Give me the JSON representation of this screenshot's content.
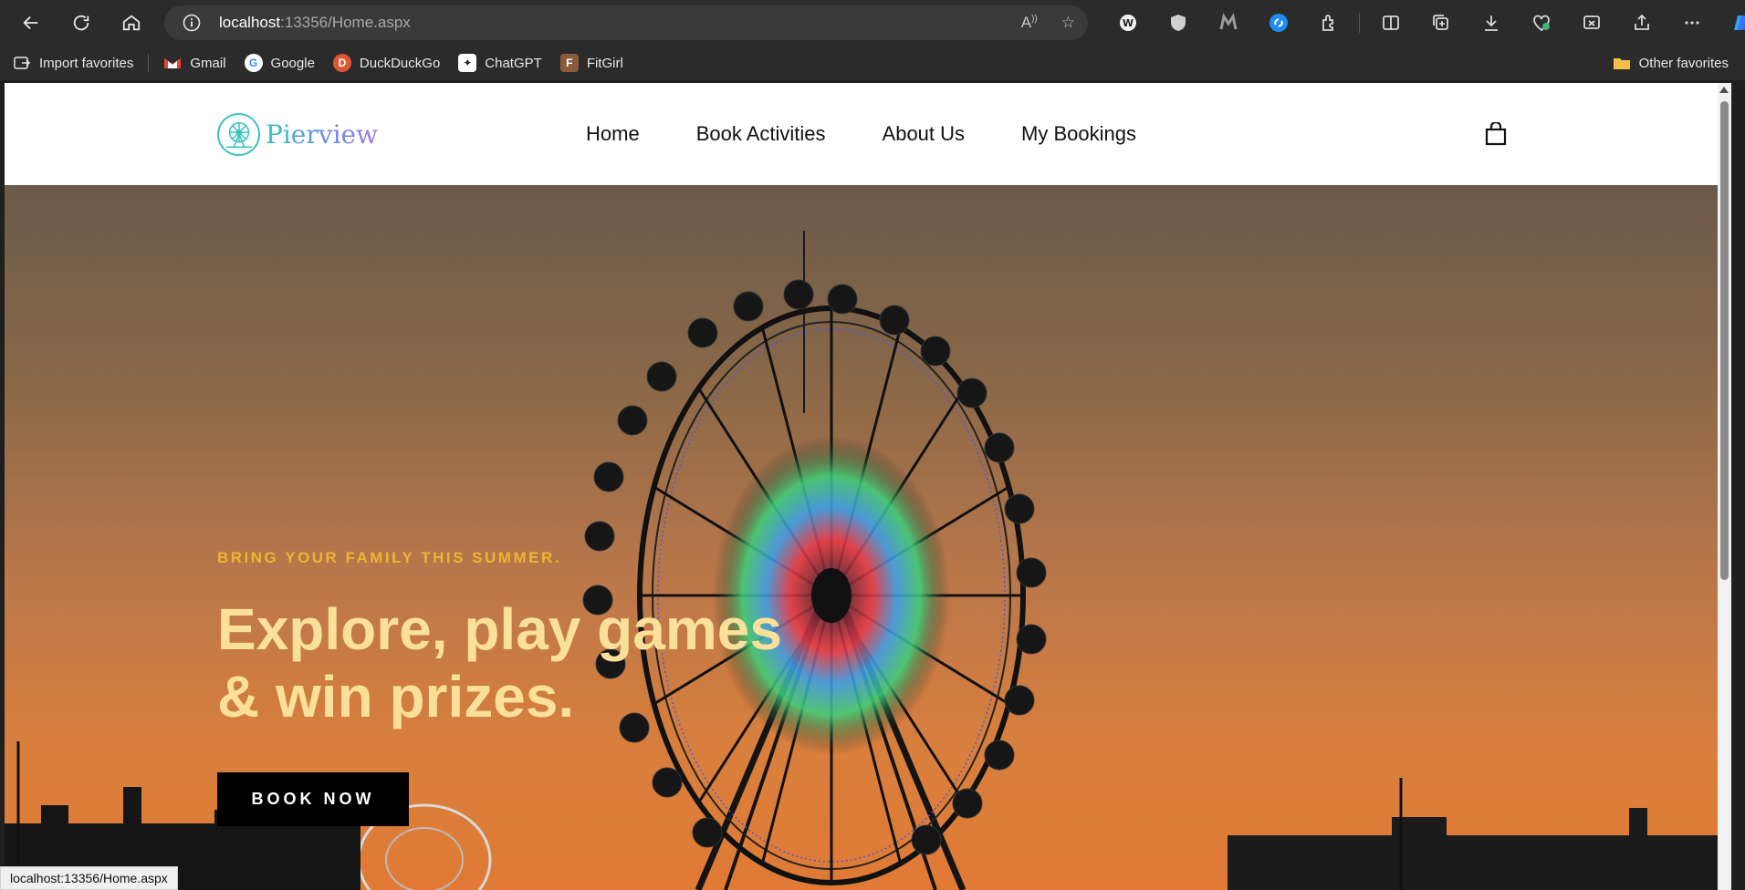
{
  "browser": {
    "url_host": "localhost",
    "url_path": ":13356/Home.aspx",
    "bookmarks": [
      {
        "label": "Import favorites",
        "icon": "import-icon"
      },
      {
        "label": "Gmail",
        "icon": "gmail-icon"
      },
      {
        "label": "Google",
        "icon": "google-icon"
      },
      {
        "label": "DuckDuckGo",
        "icon": "duckduckgo-icon"
      },
      {
        "label": "ChatGPT",
        "icon": "chatgpt-icon"
      },
      {
        "label": "FitGirl",
        "icon": "fitgirl-icon"
      }
    ],
    "other_favorites": "Other favorites",
    "status_url": "localhost:13356/Home.aspx"
  },
  "site": {
    "logo_text": "Pierview",
    "nav": [
      "Home",
      "Book Activities",
      "About Us",
      "My Bookings"
    ],
    "cart_icon": "shopping-bag-icon"
  },
  "hero": {
    "kicker": "BRING YOUR FAMILY THIS SUMMER.",
    "title_line1": "Explore, play games",
    "title_line2": "& win prizes.",
    "cta": "BOOK NOW"
  },
  "colors": {
    "kicker": "#f0b431",
    "title": "#fbe09a",
    "cta_bg": "#000000",
    "logo_teal": "#35c3bf"
  }
}
